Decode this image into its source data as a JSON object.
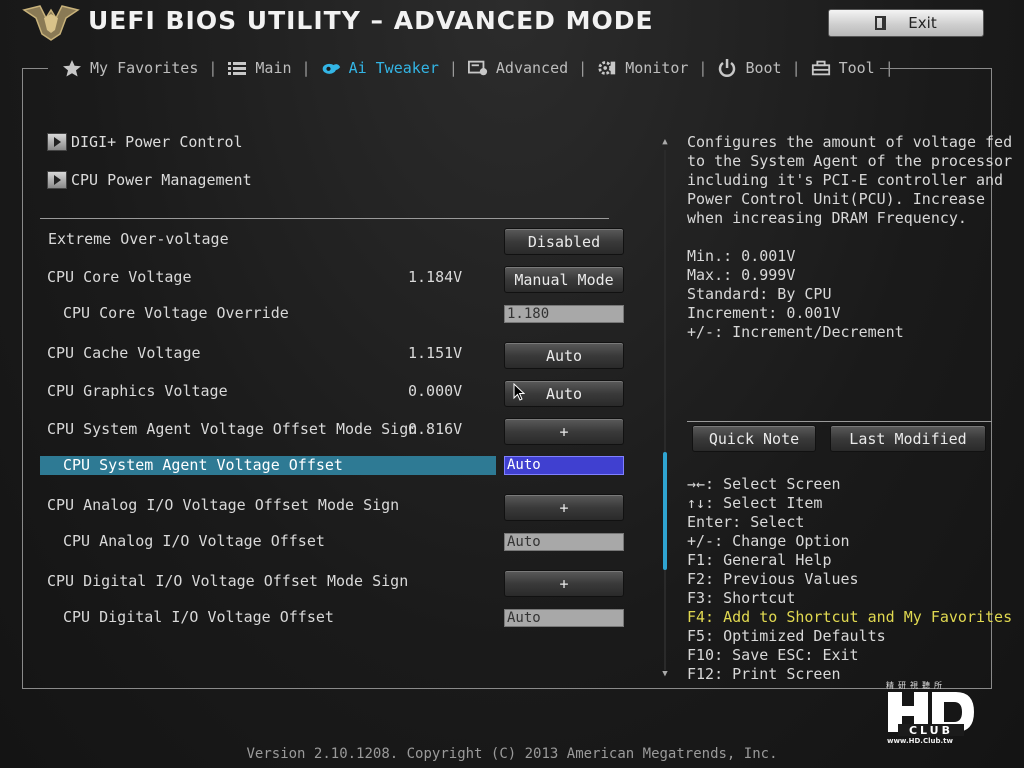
{
  "header": {
    "title": "UEFI BIOS UTILITY – ADVANCED MODE",
    "exit_label": "Exit"
  },
  "tabs": [
    {
      "label": "My Favorites",
      "icon": "star-icon"
    },
    {
      "label": "Main",
      "icon": "list-icon"
    },
    {
      "label": "Ai Tweaker",
      "icon": "ai-tweaker-icon",
      "active": true
    },
    {
      "label": "Advanced",
      "icon": "advanced-icon"
    },
    {
      "label": "Monitor",
      "icon": "monitor-gear-icon"
    },
    {
      "label": "Boot",
      "icon": "power-icon"
    },
    {
      "label": "Tool",
      "icon": "tool-icon"
    }
  ],
  "submenus": [
    {
      "label": "DIGI+ Power Control"
    },
    {
      "label": "CPU Power Management"
    }
  ],
  "settings": [
    {
      "label": "Extreme Over-voltage",
      "reading": "",
      "control": "Disabled"
    },
    {
      "label": "CPU Core Voltage",
      "reading": "1.184V",
      "control": "Manual Mode"
    },
    {
      "label": "CPU Core Voltage Override",
      "reading": "",
      "control": "1.180"
    },
    {
      "label": "CPU Cache Voltage",
      "reading": "1.151V",
      "control": "Auto"
    },
    {
      "label": "CPU Graphics Voltage",
      "reading": "0.000V",
      "control": "Auto"
    },
    {
      "label": "CPU System Agent Voltage Offset Mode Sign",
      "reading": "0.816V",
      "control": "+"
    },
    {
      "label": "CPU System Agent Voltage Offset",
      "reading": "",
      "control": "Auto",
      "selected": true
    },
    {
      "label": "CPU Analog I/O Voltage Offset Mode Sign",
      "reading": "",
      "control": "+"
    },
    {
      "label": "CPU Analog I/O Voltage Offset",
      "reading": "",
      "control": "Auto"
    },
    {
      "label": "CPU Digital I/O Voltage Offset Mode Sign",
      "reading": "",
      "control": "+"
    },
    {
      "label": "CPU Digital I/O Voltage Offset",
      "reading": "",
      "control": "Auto"
    }
  ],
  "help": {
    "description": "Configures the amount of voltage fed\nto the System Agent of the processor\nincluding it's PCI-E controller and\nPower Control Unit(PCU). Increase\nwhen increasing DRAM Frequency.",
    "specs": "Min.: 0.001V\nMax.: 0.999V\nStandard: By CPU\nIncrement: 0.001V\n+/-: Increment/Decrement",
    "quick_note": "Quick Note",
    "last_modified": "Last Modified"
  },
  "keys": [
    "→←: Select Screen",
    "↑↓: Select Item",
    "Enter: Select",
    "+/-: Change Option",
    "F1: General Help",
    "F2: Previous Values",
    "F3: Shortcut",
    "F4: Add to Shortcut and My Favorites",
    "F5: Optimized Defaults",
    "F10: Save  ESC: Exit",
    "F12: Print Screen"
  ],
  "watermark": {
    "top_text": "精研視聽所",
    "logo_text": "HD",
    "sub_text": "CLUB",
    "url": "www.HD.Club.tw"
  },
  "footer": "Version 2.10.1208. Copyright (C) 2013 American Megatrends, Inc.",
  "colors": {
    "accent": "#33b5e5",
    "highlight_row": "#2e7a94",
    "selected_field": "#4040d0",
    "favorites_key": "#e0d850"
  }
}
